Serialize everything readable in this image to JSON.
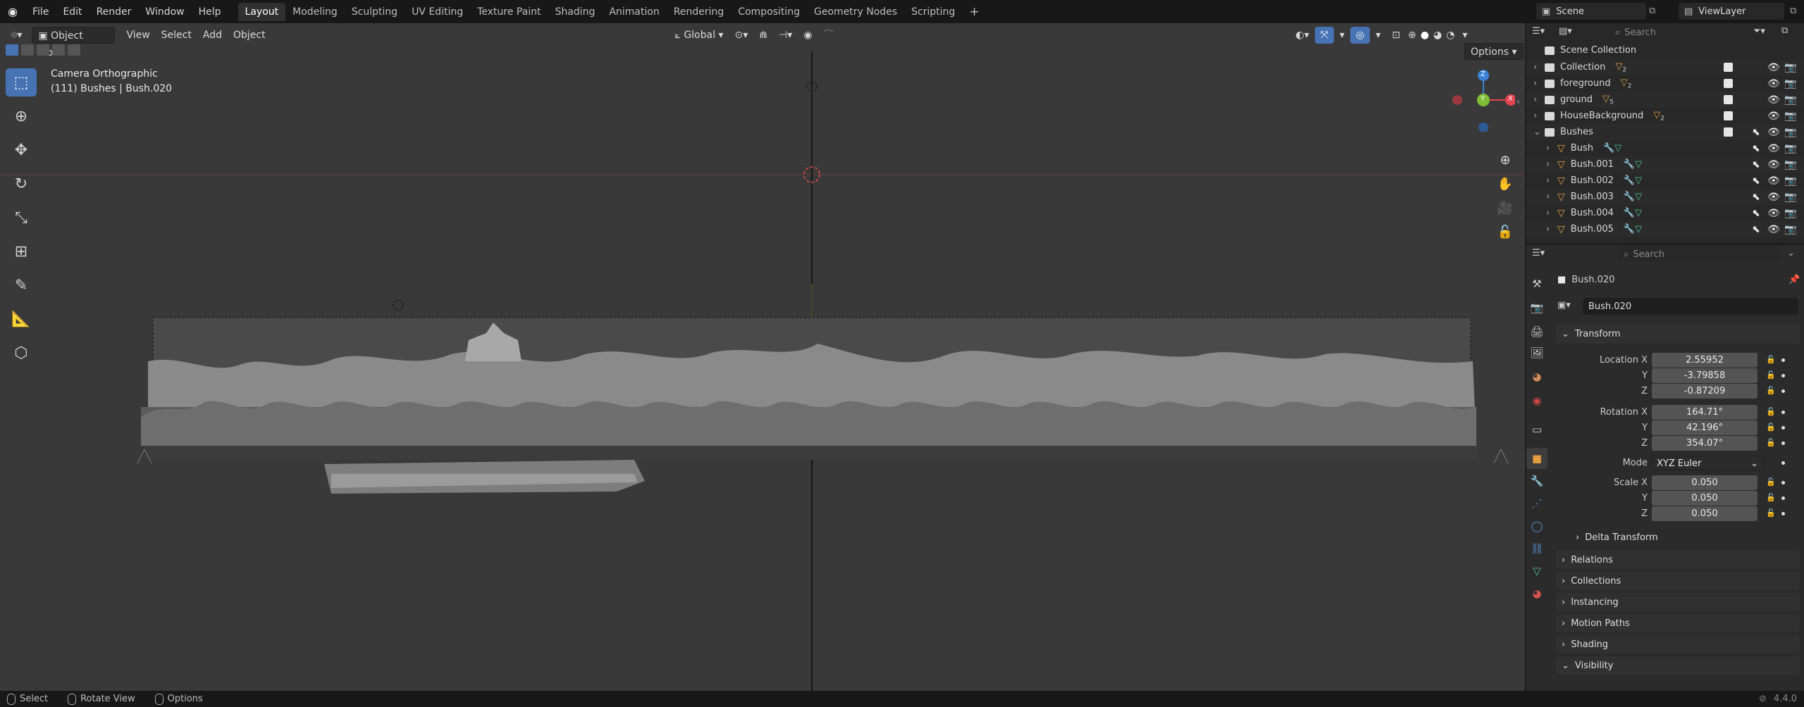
{
  "topbar": {
    "menus": [
      "File",
      "Edit",
      "Render",
      "Window",
      "Help"
    ],
    "workspaces": [
      "Layout",
      "Modeling",
      "Sculpting",
      "UV Editing",
      "Texture Paint",
      "Shading",
      "Animation",
      "Rendering",
      "Compositing",
      "Geometry Nodes",
      "Scripting"
    ],
    "active_workspace": "Layout",
    "scene": "Scene",
    "view_layer": "ViewLayer"
  },
  "viewport": {
    "mode": "Object Mode",
    "menus": [
      "View",
      "Select",
      "Add",
      "Object"
    ],
    "transform_orientation": "Global",
    "options_label": "Options",
    "view_title": "Camera Orthographic",
    "view_subtitle": "(111) Bushes | Bush.020",
    "gizmo": {
      "x": "X",
      "y": "Y",
      "z": "Z"
    }
  },
  "outliner": {
    "search_placeholder": "Search",
    "root": "Scene Collection",
    "rows": [
      {
        "name": "Collection",
        "type": "collection",
        "badge": "2"
      },
      {
        "name": "foreground",
        "type": "collection",
        "badge": "2"
      },
      {
        "name": "ground",
        "type": "collection",
        "badge": "5"
      },
      {
        "name": "HouseBackground",
        "type": "collection",
        "badge": "2"
      },
      {
        "name": "Bushes",
        "type": "collection",
        "badge": ""
      },
      {
        "name": "Bush",
        "type": "mesh",
        "badge": ""
      },
      {
        "name": "Bush.001",
        "type": "mesh",
        "badge": ""
      },
      {
        "name": "Bush.002",
        "type": "mesh",
        "badge": ""
      },
      {
        "name": "Bush.003",
        "type": "mesh",
        "badge": ""
      },
      {
        "name": "Bush.004",
        "type": "mesh",
        "badge": ""
      },
      {
        "name": "Bush.005",
        "type": "mesh",
        "badge": ""
      }
    ]
  },
  "properties": {
    "search_placeholder": "Search",
    "context_object": "Bush.020",
    "object_name": "Bush.020",
    "transform_label": "Transform",
    "location": {
      "label": "Location X",
      "x": "2.55952",
      "y": "-3.79858",
      "z": "-0.87209"
    },
    "rotation": {
      "label": "Rotation X",
      "x": "164.71°",
      "y": "42.196°",
      "z": "354.07°"
    },
    "mode": {
      "label": "Mode",
      "value": "XYZ Euler"
    },
    "scale": {
      "label": "Scale X",
      "x": "0.050",
      "y": "0.050",
      "z": "0.050"
    },
    "axis_y": "Y",
    "axis_z": "Z",
    "delta_transform": "Delta Transform",
    "panels": [
      "Relations",
      "Collections",
      "Instancing",
      "Motion Paths",
      "Shading",
      "Visibility"
    ]
  },
  "statusbar": {
    "items": [
      "Select",
      "Rotate View",
      "Options"
    ],
    "version": "4.4.0"
  },
  "colors": {
    "accent": "#4772b3",
    "x_axis": "#e5434f",
    "y_axis": "#7fbd36",
    "z_axis": "#3b82d6",
    "mesh_orange": "#e39b42"
  }
}
